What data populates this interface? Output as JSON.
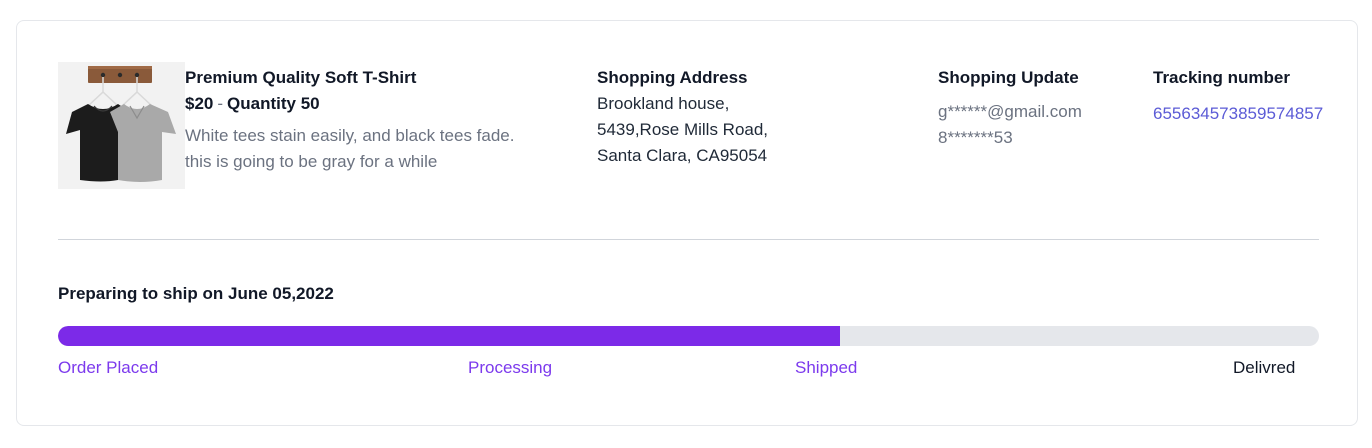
{
  "product": {
    "image_alt": "black and gray t-shirts on hanger",
    "name": "Premium Quality Soft T-Shirt",
    "price": "$20",
    "separator": "-",
    "quantity": "Quantity 50",
    "description_lines": [
      "White tees stain easily, and black tees fade.",
      "this is going to be gray for a while"
    ]
  },
  "shipping_address": {
    "heading": "Shopping Address",
    "lines": [
      "Brookland house,",
      "5439,Rose Mills Road,",
      "Santa Clara, CA95054"
    ]
  },
  "shopping_update": {
    "heading": "Shopping Update",
    "email": "g******@gmail.com",
    "phone": "8*******53"
  },
  "tracking": {
    "heading": "Tracking number",
    "number": "655634573859574857"
  },
  "shipment": {
    "status_text": "Preparing to ship on June 05,2022",
    "progress_fraction": 0.62,
    "steps": [
      {
        "label": "Order Placed",
        "completed": true
      },
      {
        "label": "Processing",
        "completed": true
      },
      {
        "label": "Shipped",
        "completed": true
      },
      {
        "label": "Delivred",
        "completed": false
      }
    ]
  },
  "colors": {
    "accent": "#7c2ae8",
    "link": "#5b5bd6",
    "track": "#e5e7eb",
    "muted_text": "#6b7280"
  }
}
